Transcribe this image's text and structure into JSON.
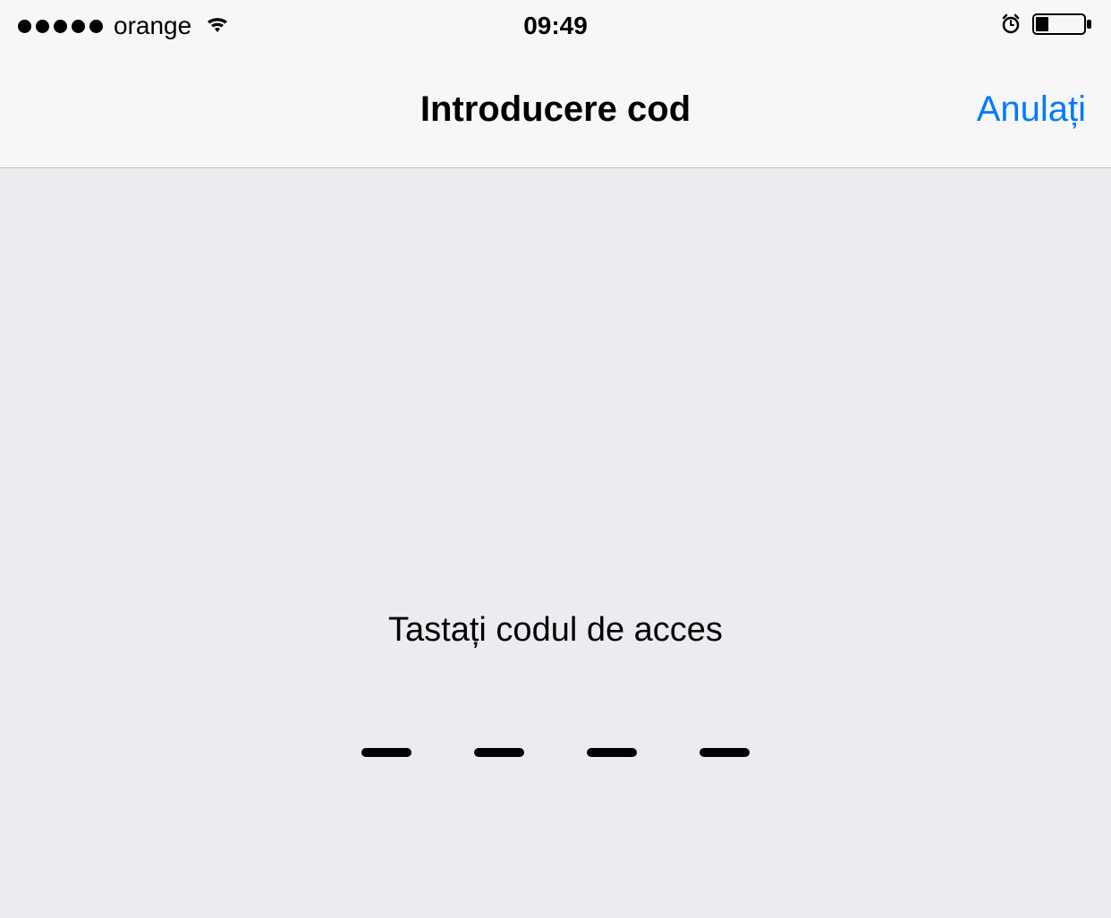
{
  "status_bar": {
    "carrier": "orange",
    "time": "09:49"
  },
  "nav": {
    "title": "Introducere cod",
    "cancel_label": "Anulați"
  },
  "content": {
    "prompt": "Tastați codul de acces",
    "passcode_length": 4
  }
}
